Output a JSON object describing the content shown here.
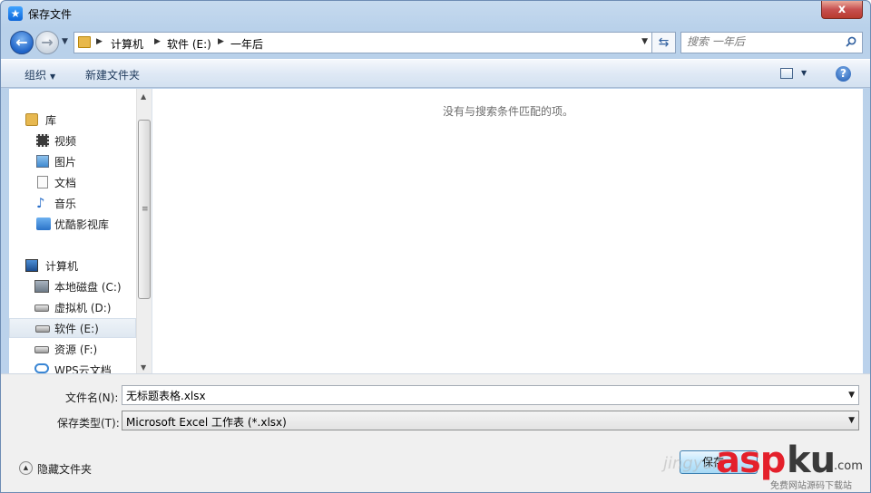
{
  "window": {
    "title": "保存文件",
    "close_label": "x"
  },
  "address": {
    "crumbs": [
      "计算机",
      "软件 (E:)",
      "一年后"
    ],
    "search_placeholder": "搜索 一年后"
  },
  "toolbar": {
    "organize_label": "组织",
    "new_folder_label": "新建文件夹"
  },
  "nav": {
    "items": [
      {
        "label": "库",
        "icon": "library-icon"
      },
      {
        "label": "视频",
        "icon": "video-icon"
      },
      {
        "label": "图片",
        "icon": "picture-icon"
      },
      {
        "label": "文档",
        "icon": "document-icon"
      },
      {
        "label": "音乐",
        "icon": "music-icon"
      },
      {
        "label": "优酷影视库",
        "icon": "youku-folder-icon"
      },
      {
        "label": "计算机",
        "icon": "computer-icon"
      },
      {
        "label": "本地磁盘 (C:)",
        "icon": "system-drive-icon"
      },
      {
        "label": "虚拟机 (D:)",
        "icon": "drive-icon"
      },
      {
        "label": "软件 (E:)",
        "icon": "drive-icon",
        "selected": true
      },
      {
        "label": "资源 (F:)",
        "icon": "drive-icon"
      },
      {
        "label": "WPS云文档",
        "icon": "cloud-icon"
      }
    ]
  },
  "content": {
    "empty_message": "没有与搜索条件匹配的项。"
  },
  "form": {
    "filename_label": "文件名(N):",
    "filename_value": "无标题表格.xlsx",
    "filetype_label": "保存类型(T):",
    "filetype_value": "Microsoft Excel 工作表 (*.xlsx)",
    "hide_folders_label": "隐藏文件夹",
    "save_label": "保存"
  },
  "watermark": {
    "brand_red": "asp",
    "brand_dark": "ku",
    "suffix": ".com",
    "tagline": "免费网站源码下载站",
    "ghost_text": "jingyan"
  },
  "colors": {
    "accent": "#1f64c8",
    "watermark_red": "#e4202b"
  }
}
